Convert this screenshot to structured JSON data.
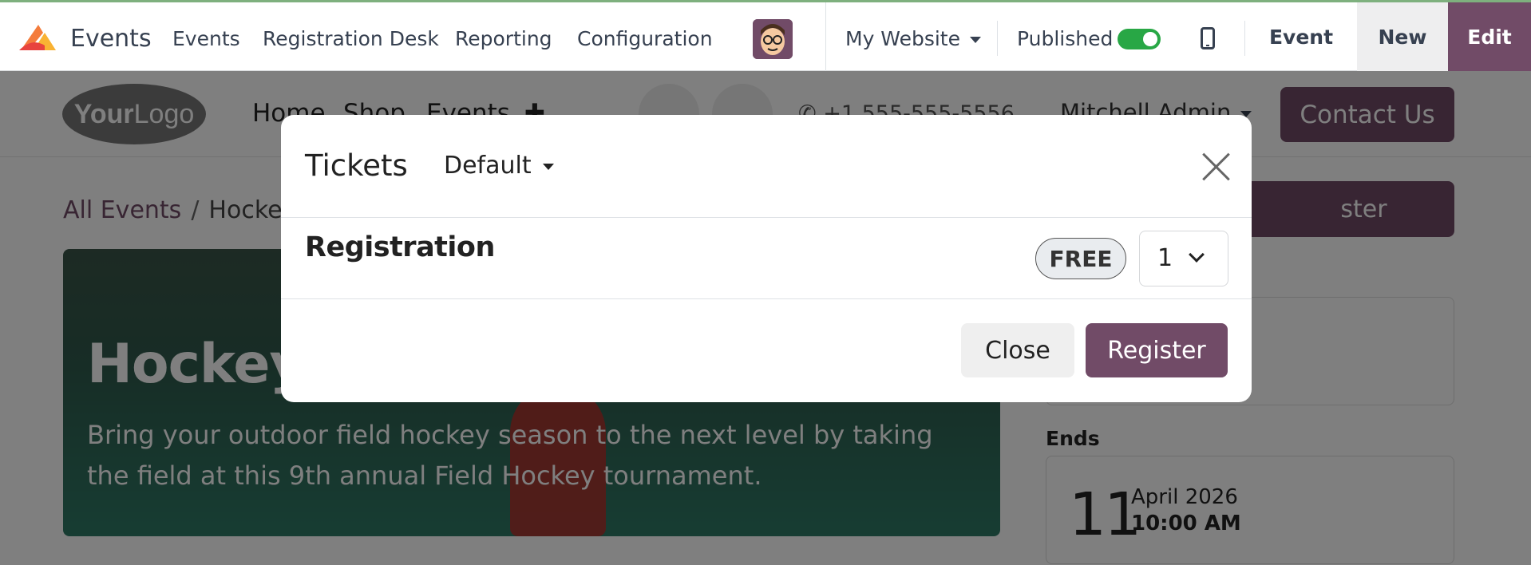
{
  "topbar": {
    "app_name": "Events",
    "menu": [
      "Events",
      "Registration Desk",
      "Reporting",
      "Configuration"
    ],
    "website": "My Website",
    "published_label": "Published",
    "published": true,
    "event_button": "Event",
    "new_button": "New",
    "edit_button": "Edit"
  },
  "site": {
    "logo_bold": "Your",
    "logo_rest": "Logo",
    "nav": [
      "Home",
      "Shop",
      "Events"
    ],
    "phone": "+1 555-555-5556",
    "user": "Mitchell Admin",
    "contact_button": "Contact Us",
    "breadcrumb_link": "All Events",
    "breadcrumb_sep": "/",
    "breadcrumb_current": "Hockey",
    "register_button_partial": "ster",
    "hero_title": "Hockey",
    "hero_description": "Bring your outdoor field hockey season to the next level by taking the field at this 9th annual Field Hockey tournament.",
    "ends_label": "Ends",
    "end_day": "11",
    "end_month_year": "April 2026",
    "end_time": "10:00 AM"
  },
  "modal": {
    "title": "Tickets",
    "pricelist": "Default",
    "ticket_name": "Registration",
    "price_badge": "FREE",
    "quantity": "1",
    "close_button": "Close",
    "register_button": "Register"
  },
  "colors": {
    "brand": "#714b67",
    "toggle_on": "#28a745"
  }
}
